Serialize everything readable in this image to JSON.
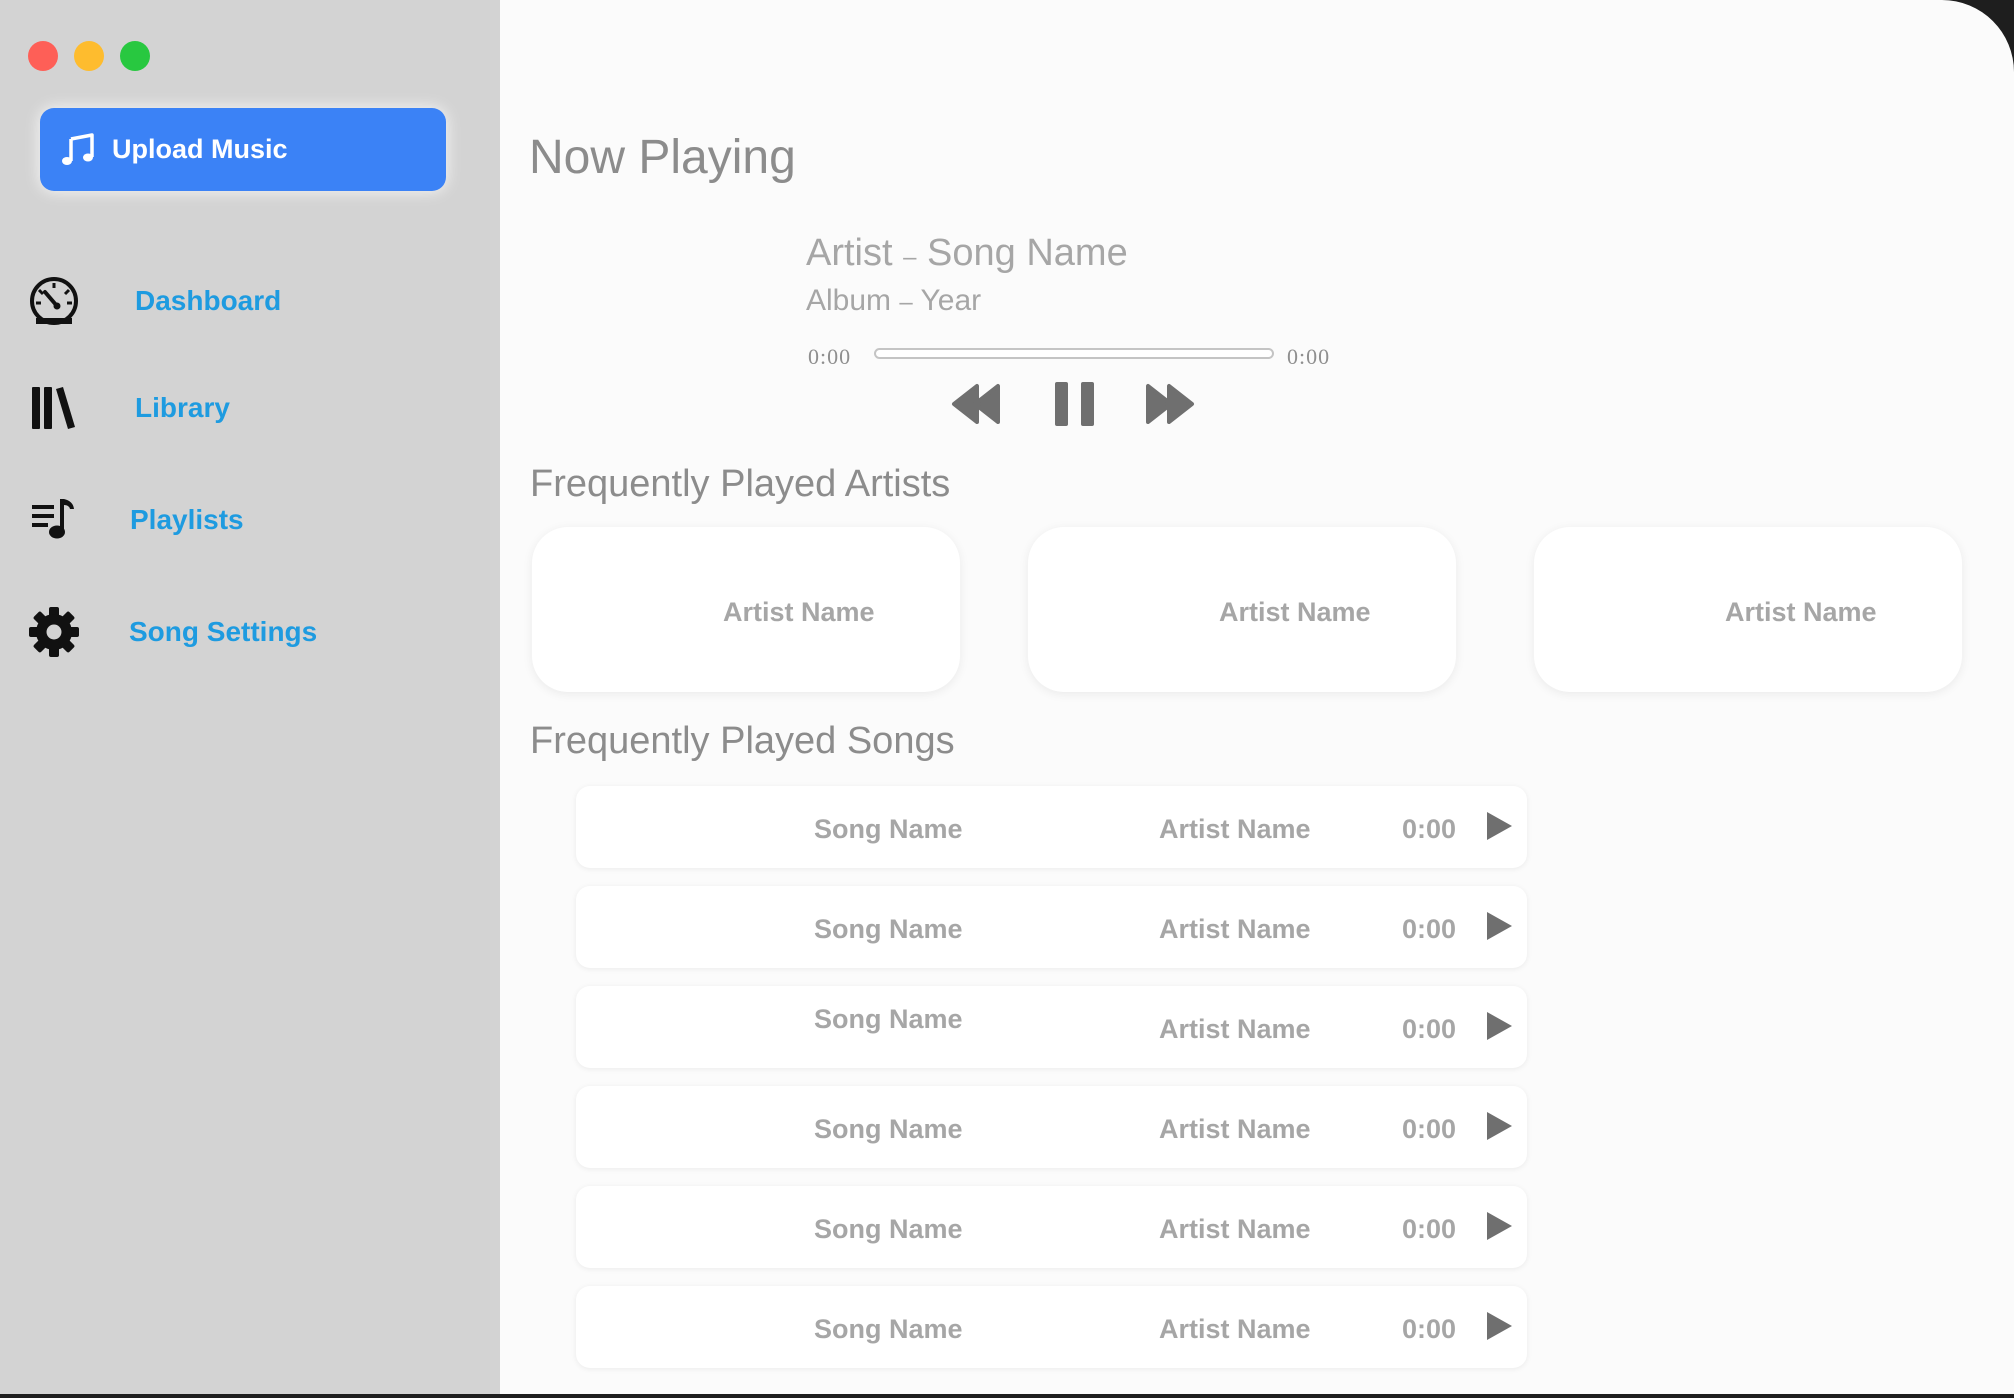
{
  "sidebar": {
    "upload_label": "Upload Music",
    "nav": [
      {
        "label": "Dashboard",
        "icon": "dashboard-gauge-icon"
      },
      {
        "label": "Library",
        "icon": "library-books-icon"
      },
      {
        "label": "Playlists",
        "icon": "playlist-music-icon"
      },
      {
        "label": "Song Settings",
        "icon": "gear-icon"
      }
    ]
  },
  "now_playing": {
    "title": "Now Playing",
    "artist": "Artist",
    "song": "Song Name",
    "album": "Album",
    "year": "Year",
    "separator": "–",
    "time_start": "0:00",
    "time_end": "0:00",
    "progress": 0
  },
  "artists_section": {
    "title": "Frequently Played Artists",
    "artists": [
      "Artist Name",
      "Artist Name",
      "Artist Name"
    ]
  },
  "songs_section": {
    "title": "Frequently Played Songs",
    "songs": [
      {
        "song": "Song Name",
        "artist": "Artist Name",
        "duration": "0:00"
      },
      {
        "song": "Song Name",
        "artist": "Artist Name",
        "duration": "0:00"
      },
      {
        "song": "Song Name",
        "artist": "Artist Name",
        "duration": "0:00"
      },
      {
        "song": "Song Name",
        "artist": "Artist Name",
        "duration": "0:00"
      },
      {
        "song": "Song Name",
        "artist": "Artist Name",
        "duration": "0:00"
      },
      {
        "song": "Song Name",
        "artist": "Artist Name",
        "duration": "0:00"
      }
    ]
  },
  "colors": {
    "accent": "#3b82f6",
    "nav_text": "#1e9be0",
    "sidebar_bg": "#d3d3d3",
    "muted_text": "#a6a6a6"
  }
}
